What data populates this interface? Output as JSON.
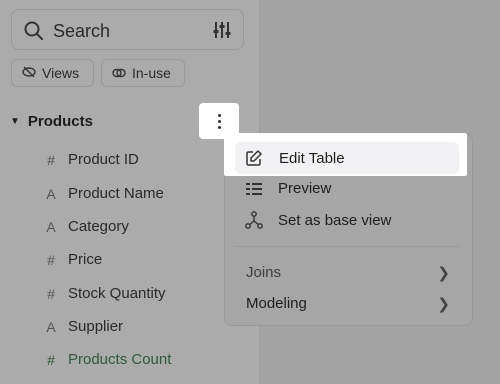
{
  "search": {
    "placeholder": "Search"
  },
  "filters": {
    "views_label": "Views",
    "inuse_label": "In-use"
  },
  "section": {
    "title": "Products"
  },
  "fields": [
    {
      "icon": "#",
      "label": "Product ID"
    },
    {
      "icon": "A",
      "label": "Product Name"
    },
    {
      "icon": "A",
      "label": "Category"
    },
    {
      "icon": "#",
      "label": "Price"
    },
    {
      "icon": "#",
      "label": "Stock Quantity"
    },
    {
      "icon": "A",
      "label": "Supplier"
    },
    {
      "icon": "#",
      "label": "Products Count"
    }
  ],
  "menu": {
    "edit_table": "Edit Table",
    "preview": "Preview",
    "set_base_view": "Set as base view",
    "joins": "Joins",
    "modeling": "Modeling"
  },
  "colors": {
    "count_field": "#2d5a3a",
    "highlight": "#ffffff"
  }
}
